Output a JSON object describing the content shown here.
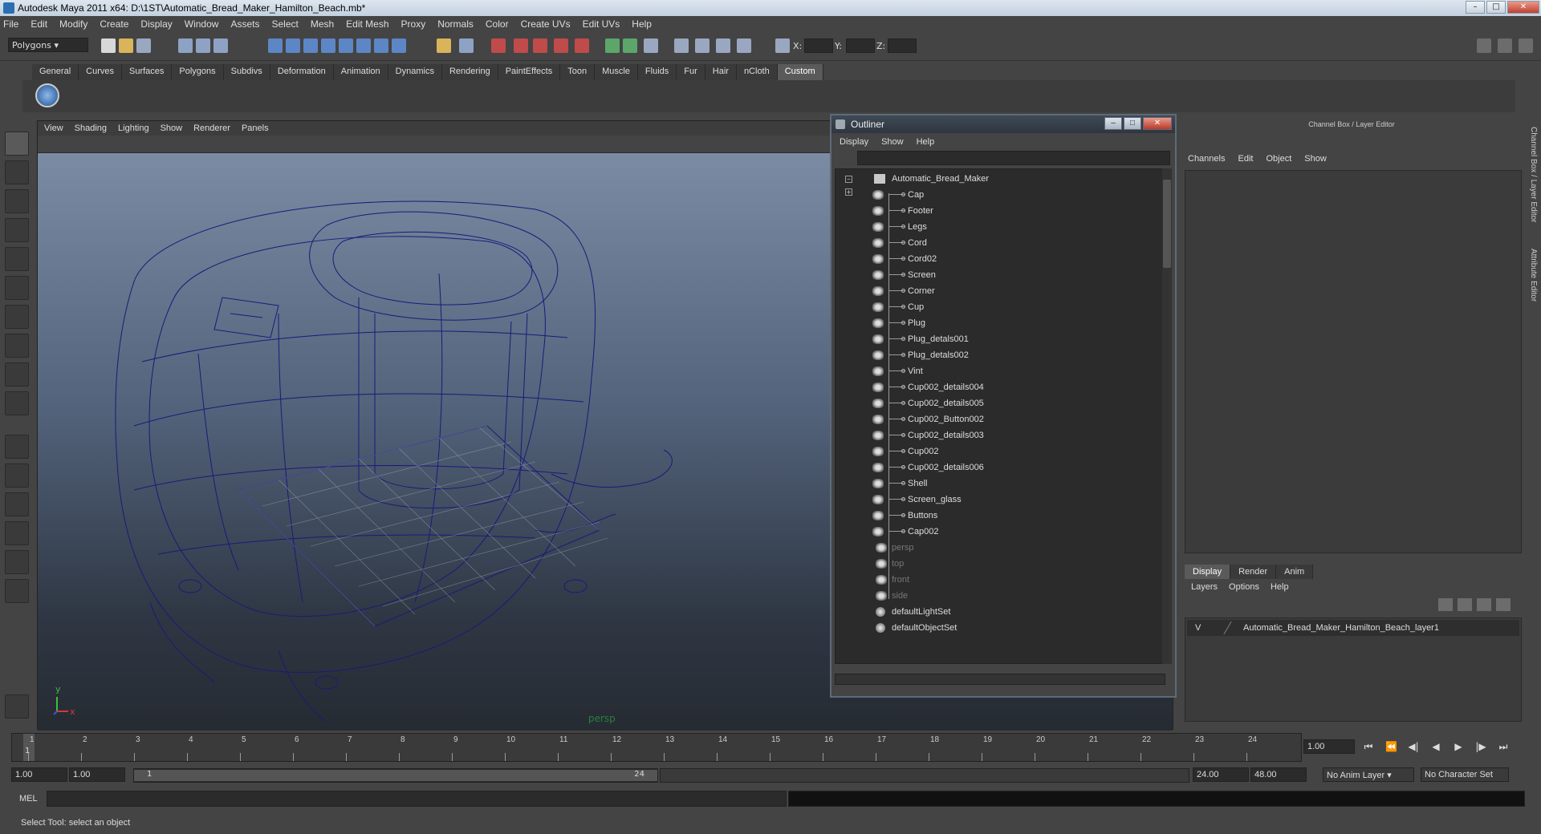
{
  "window": {
    "title": "Autodesk Maya 2011 x64: D:\\1ST\\Automatic_Bread_Maker_Hamilton_Beach.mb*"
  },
  "menubar": [
    "File",
    "Edit",
    "Modify",
    "Create",
    "Display",
    "Window",
    "Assets",
    "Select",
    "Mesh",
    "Edit Mesh",
    "Proxy",
    "Normals",
    "Color",
    "Create UVs",
    "Edit UVs",
    "Help"
  ],
  "toolbar": {
    "mode": "Polygons",
    "x_label": "X:",
    "y_label": "Y:",
    "z_label": "Z:"
  },
  "shelf_tabs": [
    "General",
    "Curves",
    "Surfaces",
    "Polygons",
    "Subdivs",
    "Deformation",
    "Animation",
    "Dynamics",
    "Rendering",
    "PaintEffects",
    "Toon",
    "Muscle",
    "Fluids",
    "Fur",
    "Hair",
    "nCloth",
    "Custom"
  ],
  "shelf_active_tab": "Custom",
  "viewport": {
    "menu": [
      "View",
      "Shading",
      "Lighting",
      "Show",
      "Renderer",
      "Panels"
    ],
    "camera_label": "persp",
    "axis_y": "y",
    "axis_x": "x"
  },
  "outliner": {
    "title": "Outliner",
    "menu": [
      "Display",
      "Show",
      "Help"
    ],
    "root": "Automatic_Bread_Maker",
    "children": [
      "Cap",
      "Footer",
      "Legs",
      "Cord",
      "Cord02",
      "Screen",
      "Corner",
      "Cup",
      "Plug",
      "Plug_detals001",
      "Plug_detals002",
      "Vint",
      "Cup002_details004",
      "Cup002_details005",
      "Cup002_Button002",
      "Cup002_details003",
      "Cup002",
      "Cup002_details006",
      "Shell",
      "Screen_glass",
      "Buttons",
      "Cap002"
    ],
    "cameras": [
      "persp",
      "top",
      "front",
      "side"
    ],
    "sets": [
      "defaultLightSet",
      "defaultObjectSet"
    ]
  },
  "channel_box": {
    "header": "Channel Box / Layer Editor",
    "menu": [
      "Channels",
      "Edit",
      "Object",
      "Show"
    ],
    "layer_tabs": [
      "Display",
      "Render",
      "Anim"
    ],
    "layer_menu": [
      "Layers",
      "Options",
      "Help"
    ],
    "layer": {
      "visible": "V",
      "name": "Automatic_Bread_Maker_Hamilton_Beach_layer1"
    }
  },
  "side_tabs": [
    "Channel Box / Layer Editor",
    "Attribute Editor"
  ],
  "timeline": {
    "ticks": [
      "1",
      "2",
      "3",
      "4",
      "5",
      "6",
      "7",
      "8",
      "9",
      "10",
      "11",
      "12",
      "13",
      "14",
      "15",
      "16",
      "17",
      "18",
      "19",
      "20",
      "21",
      "22",
      "23",
      "24"
    ],
    "current_frame": "1",
    "current_time": "1.00"
  },
  "range": {
    "start": "1.00",
    "start2": "1.00",
    "handle_start": "1",
    "handle_end": "24",
    "end": "24.00",
    "end2": "48.00",
    "anim_layer": "No Anim Layer",
    "character_set": "No Character Set"
  },
  "command": {
    "label": "MEL"
  },
  "help_line": "Select Tool: select an object",
  "colors": {
    "bg": "#444444",
    "wire": "#1a1a7a",
    "accent": "#5a5a5a"
  }
}
